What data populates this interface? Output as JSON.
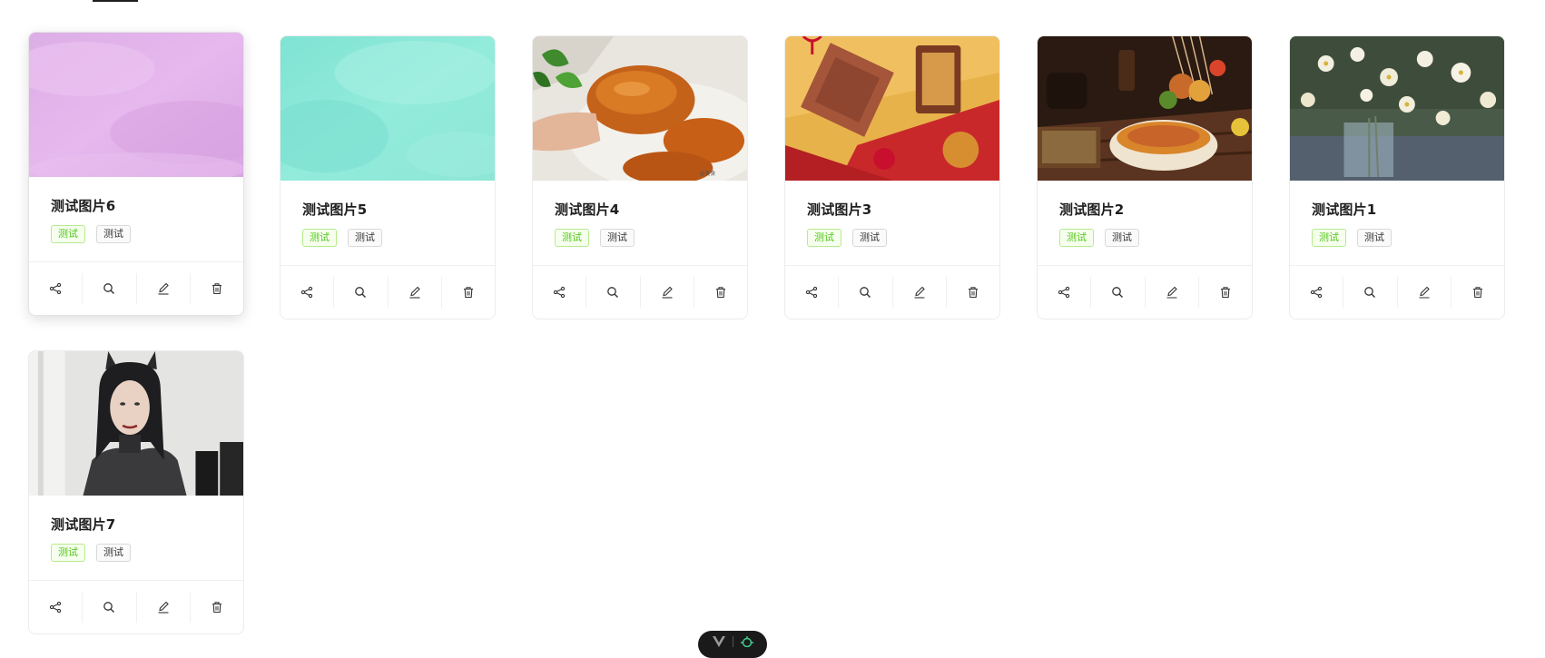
{
  "cards": [
    {
      "title": "测试图片6",
      "tags": [
        "测试",
        "测试"
      ]
    },
    {
      "title": "测试图片5",
      "tags": [
        "测试",
        "测试"
      ]
    },
    {
      "title": "测试图片4",
      "tags": [
        "测试",
        "测试"
      ]
    },
    {
      "title": "测试图片3",
      "tags": [
        "测试",
        "测试"
      ]
    },
    {
      "title": "测试图片2",
      "tags": [
        "测试",
        "测试"
      ]
    },
    {
      "title": "测试图片1",
      "tags": [
        "测试",
        "测试"
      ]
    },
    {
      "title": "测试图片7",
      "tags": [
        "测试",
        "测试"
      ]
    }
  ],
  "card_actions": [
    "share-icon",
    "search-icon",
    "edit-icon",
    "delete-icon"
  ],
  "colors": {
    "tag_green": "#52c41a",
    "tag_green_bg": "#f6ffed",
    "tag_default": "#333333"
  }
}
